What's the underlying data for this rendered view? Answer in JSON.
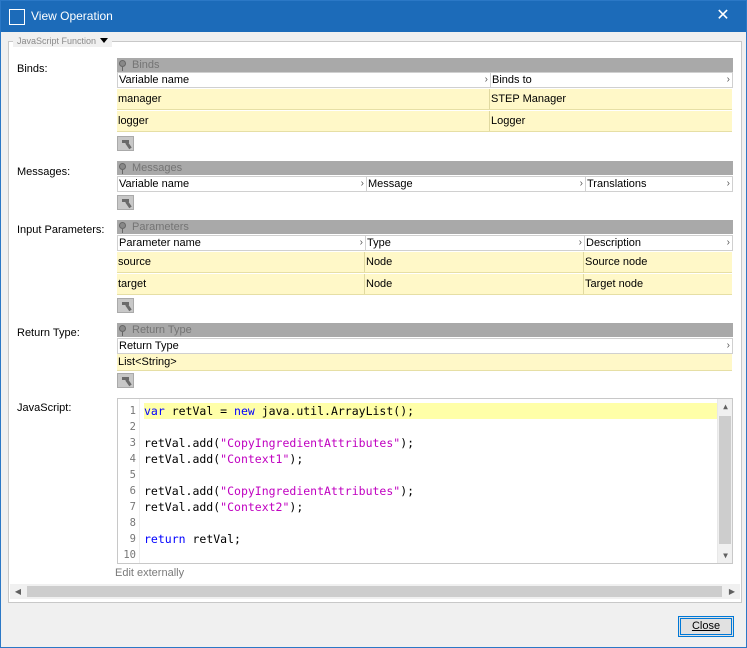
{
  "window": {
    "title": "View Operation",
    "close_glyph": "✕"
  },
  "panel": {
    "legend": "JavaScript Function"
  },
  "binds": {
    "label": "Binds:",
    "group": "Binds",
    "columns": [
      "Variable name",
      "Binds to"
    ],
    "rows": [
      [
        "manager",
        "STEP Manager"
      ],
      [
        "logger",
        "Logger"
      ]
    ]
  },
  "messages": {
    "label": "Messages:",
    "group": "Messages",
    "columns": [
      "Variable name",
      "Message",
      "Translations"
    ],
    "rows": []
  },
  "parameters": {
    "label": "Input Parameters:",
    "group": "Parameters",
    "columns": [
      "Parameter name",
      "Type",
      "Description"
    ],
    "rows": [
      [
        "source",
        "Node",
        "Source node"
      ],
      [
        "target",
        "Node",
        "Target node"
      ]
    ]
  },
  "return_type": {
    "label": "Return Type:",
    "group": "Return Type",
    "columns": [
      "Return Type"
    ],
    "rows": [
      [
        "List<String>"
      ]
    ]
  },
  "javascript": {
    "label": "JavaScript:",
    "line_numbers": [
      "1",
      "2",
      "3",
      "4",
      "5",
      "6",
      "7",
      "8",
      "9",
      "10"
    ],
    "lines": [
      [
        [
          "kw",
          "var"
        ],
        [
          "",
          "retVal = "
        ],
        [
          "kw",
          "new"
        ],
        [
          "",
          "java.util.ArrayList();"
        ]
      ],
      [],
      [
        [
          "",
          "retVal.add("
        ],
        [
          "str",
          "\"CopyIngredientAttributes\""
        ],
        [
          "",
          ");"
        ]
      ],
      [
        [
          "",
          "retVal.add("
        ],
        [
          "str",
          "\"Context1\""
        ],
        [
          "",
          ");"
        ]
      ],
      [],
      [
        [
          "",
          "retVal.add("
        ],
        [
          "str",
          "\"CopyIngredientAttributes\""
        ],
        [
          "",
          ");"
        ]
      ],
      [
        [
          "",
          "retVal.add("
        ],
        [
          "str",
          "\"Context2\""
        ],
        [
          "",
          ");"
        ]
      ],
      [],
      [
        [
          "kw",
          "return"
        ],
        [
          "",
          "retVal;"
        ]
      ],
      []
    ],
    "edit_externally": "Edit externally"
  },
  "buttons": {
    "close": "Close"
  },
  "icons": {
    "pin": "pin-icon",
    "tool": "wrench-icon",
    "chevron": "chevron-right-icon"
  }
}
